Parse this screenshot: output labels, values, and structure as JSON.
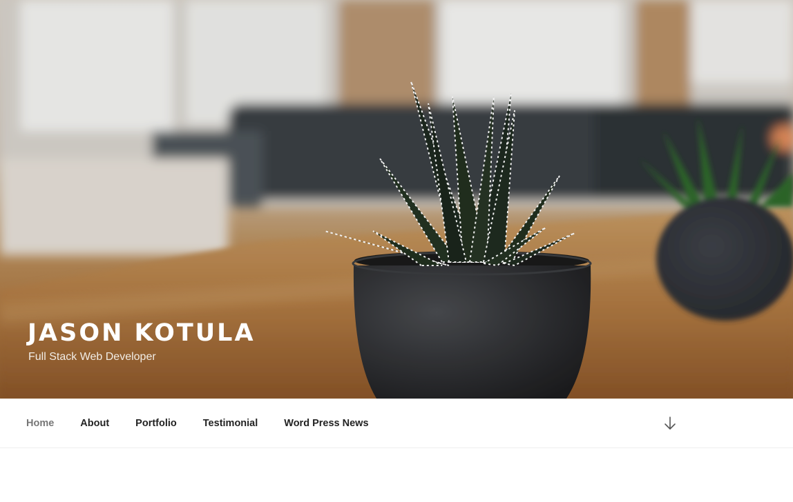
{
  "site": {
    "title": "JASON KOTULA",
    "tagline": "Full Stack Web Developer"
  },
  "header_image": {
    "description_icon": "potted-succulent-photo"
  },
  "nav": {
    "items": [
      {
        "label": "Home",
        "current": true
      },
      {
        "label": "About",
        "current": false
      },
      {
        "label": "Portfolio",
        "current": false
      },
      {
        "label": "Testimonial",
        "current": false
      },
      {
        "label": "Word Press News",
        "current": false
      }
    ],
    "scroll_icon": "arrow-down-icon"
  },
  "colors": {
    "nav_text": "#222222",
    "nav_current": "#767676",
    "title": "#ffffff"
  }
}
